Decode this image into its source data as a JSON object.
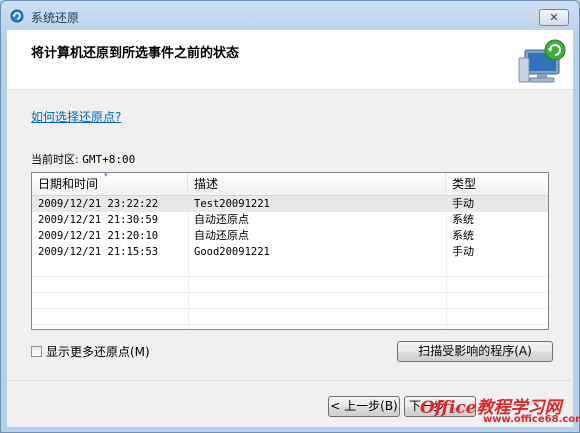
{
  "window": {
    "title": "系统还原",
    "close_label": "✕"
  },
  "header": {
    "title": "将计算机还原到所选事件之前的状态"
  },
  "help_link": "如何选择还原点?",
  "timezone": {
    "label": "当前时区:",
    "value": "GMT+8:00"
  },
  "table": {
    "columns": [
      "日期和时间",
      "描述",
      "类型"
    ],
    "sort_indicator": "▾",
    "rows": [
      {
        "datetime": "2009/12/21 23:22:22",
        "description": "Test20091221",
        "type": "手动"
      },
      {
        "datetime": "2009/12/21 21:30:59",
        "description": "自动还原点",
        "type": "系统"
      },
      {
        "datetime": "2009/12/21 21:20:10",
        "description": "自动还原点",
        "type": "系统"
      },
      {
        "datetime": "2009/12/21 21:15:53",
        "description": "Good20091221",
        "type": "手动"
      }
    ]
  },
  "show_more_checkbox": {
    "label": "显示更多还原点(M)",
    "checked": false
  },
  "scan_button": "扫描受影响的程序(A)",
  "back_button": "< 上一步(B)",
  "next_button": "下一步",
  "watermark": {
    "main": "Office教程学习网",
    "url": "www.office68.com"
  }
}
